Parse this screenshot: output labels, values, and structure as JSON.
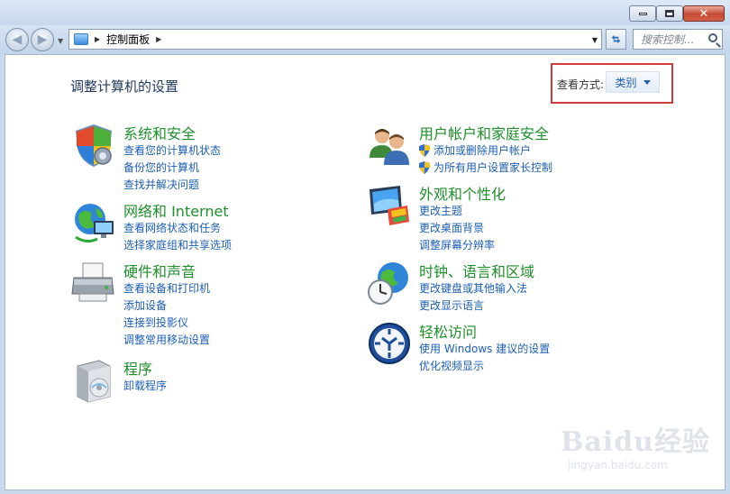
{
  "window": {
    "caption_buttons": [
      "minimize",
      "maximize",
      "close"
    ],
    "close_glyph": "✕"
  },
  "navbar": {
    "back_icon": "back-arrow-icon",
    "forward_icon": "forward-arrow-icon",
    "breadcrumb": [
      "控制面板"
    ],
    "search_placeholder": "搜索控制..."
  },
  "header": {
    "title": "调整计算机的设置",
    "view_label": "查看方式:",
    "view_value": "类别"
  },
  "categories": [
    {
      "id": "security",
      "title": "系统和安全",
      "icon": "shield-icon",
      "links": [
        "查看您的计算机状态",
        "备份您的计算机",
        "查找并解决问题"
      ]
    },
    {
      "id": "network",
      "title": "网络和 Internet",
      "icon": "network-globe-icon",
      "links": [
        "查看网络状态和任务",
        "选择家庭组和共享选项"
      ]
    },
    {
      "id": "hardware",
      "title": "硬件和声音",
      "icon": "printer-icon",
      "links": [
        "查看设备和打印机",
        "添加设备",
        "连接到投影仪",
        "调整常用移动设置"
      ]
    },
    {
      "id": "programs",
      "title": "程序",
      "icon": "programs-box-icon",
      "links": [
        "卸载程序"
      ]
    },
    {
      "id": "users",
      "title": "用户帐户和家庭安全",
      "icon": "users-icon",
      "links": [
        "添加或删除用户帐户",
        "为所有用户设置家长控制"
      ],
      "link_shields": [
        true,
        true
      ]
    },
    {
      "id": "appearance",
      "title": "外观和个性化",
      "icon": "monitor-palette-icon",
      "links": [
        "更改主题",
        "更改桌面背景",
        "调整屏幕分辨率"
      ]
    },
    {
      "id": "clock",
      "title": "时钟、语言和区域",
      "icon": "globe-clock-icon",
      "links": [
        "更改键盘或其他输入法",
        "更改显示语言"
      ]
    },
    {
      "id": "ease",
      "title": "轻松访问",
      "icon": "ease-of-access-icon",
      "links": [
        "使用 Windows 建议的设置",
        "优化视频显示"
      ]
    }
  ],
  "watermark": {
    "brand": "Baidu经验",
    "url": "jingyan.baidu.com"
  },
  "colors": {
    "link": "#1c5fb3",
    "category_title": "#1e8f2a",
    "highlight_box": "#d23b3b",
    "title": "#1e395b"
  }
}
